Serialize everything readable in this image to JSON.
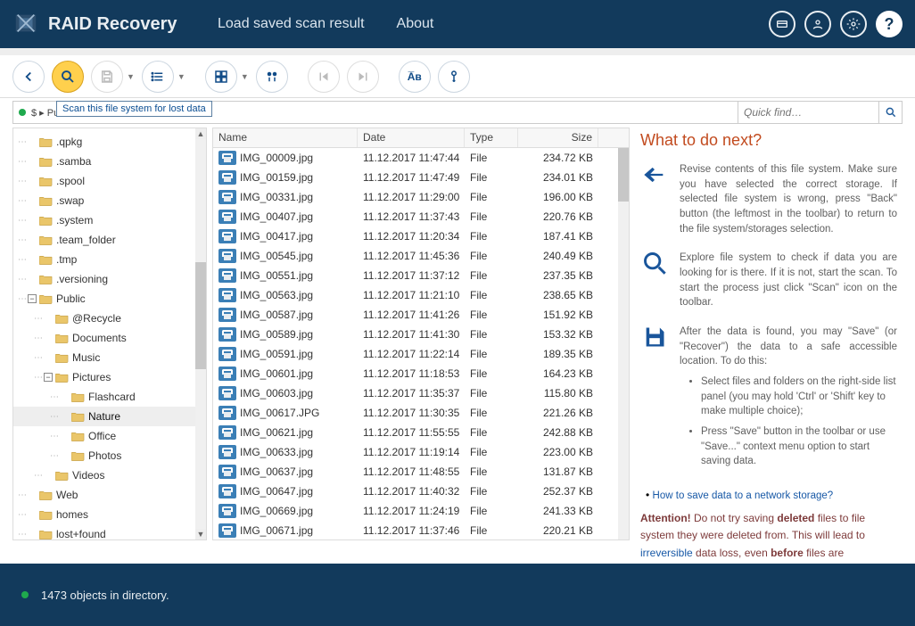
{
  "app_title": "RAID Recovery",
  "menu": {
    "load": "Load saved scan result",
    "about": "About"
  },
  "tooltip": "Scan this file system for lost data",
  "breadcrumb": "$ ▸ Public ▸ Pictures ▸ Nature",
  "quick_find_placeholder": "Quick find…",
  "tree": [
    {
      "depth": 1,
      "label": ".qpkg",
      "expandable": false
    },
    {
      "depth": 1,
      "label": ".samba",
      "expandable": false
    },
    {
      "depth": 1,
      "label": ".spool",
      "expandable": false
    },
    {
      "depth": 1,
      "label": ".swap",
      "expandable": false
    },
    {
      "depth": 1,
      "label": ".system",
      "expandable": false
    },
    {
      "depth": 1,
      "label": ".team_folder",
      "expandable": false
    },
    {
      "depth": 1,
      "label": ".tmp",
      "expandable": false
    },
    {
      "depth": 1,
      "label": ".versioning",
      "expandable": false
    },
    {
      "depth": 1,
      "label": "Public",
      "expandable": true,
      "expanded": true
    },
    {
      "depth": 2,
      "label": "@Recycle",
      "expandable": false
    },
    {
      "depth": 2,
      "label": "Documents",
      "expandable": false
    },
    {
      "depth": 2,
      "label": "Music",
      "expandable": false
    },
    {
      "depth": 2,
      "label": "Pictures",
      "expandable": true,
      "expanded": true
    },
    {
      "depth": 3,
      "label": "Flashcard",
      "expandable": false
    },
    {
      "depth": 3,
      "label": "Nature",
      "expandable": false,
      "selected": true
    },
    {
      "depth": 3,
      "label": "Office",
      "expandable": false
    },
    {
      "depth": 3,
      "label": "Photos",
      "expandable": false
    },
    {
      "depth": 2,
      "label": "Videos",
      "expandable": false
    },
    {
      "depth": 1,
      "label": "Web",
      "expandable": false
    },
    {
      "depth": 1,
      "label": "homes",
      "expandable": false
    },
    {
      "depth": 1,
      "label": "lost+found",
      "expandable": false
    }
  ],
  "columns": {
    "name": "Name",
    "date": "Date",
    "type": "Type",
    "size": "Size"
  },
  "files": [
    {
      "name": "IMG_00009.jpg",
      "date": "11.12.2017 11:47:44",
      "type": "File",
      "size": "234.72 KB"
    },
    {
      "name": "IMG_00159.jpg",
      "date": "11.12.2017 11:47:49",
      "type": "File",
      "size": "234.01 KB"
    },
    {
      "name": "IMG_00331.jpg",
      "date": "11.12.2017 11:29:00",
      "type": "File",
      "size": "196.00 KB"
    },
    {
      "name": "IMG_00407.jpg",
      "date": "11.12.2017 11:37:43",
      "type": "File",
      "size": "220.76 KB"
    },
    {
      "name": "IMG_00417.jpg",
      "date": "11.12.2017 11:20:34",
      "type": "File",
      "size": "187.41 KB"
    },
    {
      "name": "IMG_00545.jpg",
      "date": "11.12.2017 11:45:36",
      "type": "File",
      "size": "240.49 KB"
    },
    {
      "name": "IMG_00551.jpg",
      "date": "11.12.2017 11:37:12",
      "type": "File",
      "size": "237.35 KB"
    },
    {
      "name": "IMG_00563.jpg",
      "date": "11.12.2017 11:21:10",
      "type": "File",
      "size": "238.65 KB"
    },
    {
      "name": "IMG_00587.jpg",
      "date": "11.12.2017 11:41:26",
      "type": "File",
      "size": "151.92 KB"
    },
    {
      "name": "IMG_00589.jpg",
      "date": "11.12.2017 11:41:30",
      "type": "File",
      "size": "153.32 KB"
    },
    {
      "name": "IMG_00591.jpg",
      "date": "11.12.2017 11:22:14",
      "type": "File",
      "size": "189.35 KB"
    },
    {
      "name": "IMG_00601.jpg",
      "date": "11.12.2017 11:18:53",
      "type": "File",
      "size": "164.23 KB"
    },
    {
      "name": "IMG_00603.jpg",
      "date": "11.12.2017 11:35:37",
      "type": "File",
      "size": "115.80 KB"
    },
    {
      "name": "IMG_00617.JPG",
      "date": "11.12.2017 11:30:35",
      "type": "File",
      "size": "221.26 KB"
    },
    {
      "name": "IMG_00621.jpg",
      "date": "11.12.2017 11:55:55",
      "type": "File",
      "size": "242.88 KB"
    },
    {
      "name": "IMG_00633.jpg",
      "date": "11.12.2017 11:19:14",
      "type": "File",
      "size": "223.00 KB"
    },
    {
      "name": "IMG_00637.jpg",
      "date": "11.12.2017 11:48:55",
      "type": "File",
      "size": "131.87 KB"
    },
    {
      "name": "IMG_00647.jpg",
      "date": "11.12.2017 11:40:32",
      "type": "File",
      "size": "252.37 KB"
    },
    {
      "name": "IMG_00669.jpg",
      "date": "11.12.2017 11:24:19",
      "type": "File",
      "size": "241.33 KB"
    },
    {
      "name": "IMG_00671.jpg",
      "date": "11.12.2017 11:37:46",
      "type": "File",
      "size": "220.21 KB"
    }
  ],
  "side": {
    "heading": "What to do next?",
    "step1": "Revise contents of this file system. Make sure you have selected the correct storage. If selected file system is wrong, press \"Back\" button (the leftmost in the toolbar) to return to the file system/storages selection.",
    "step2": "Explore file system to check if data you are looking for is there. If it is not, start the scan. To start the process just click \"Scan\" icon on the toolbar.",
    "step3": "After the data is found, you may \"Save\" (or \"Recover\") the data to a safe accessible location. To do this:",
    "bullet1": "Select files and folders on the right-side list panel (you may hold 'Ctrl' or 'Shift' key to make multiple choice);",
    "bullet2": "Press \"Save\" button in the toolbar or use \"Save...\" context menu option to start saving data.",
    "link": "How to save data to a network storage?",
    "attention_label": "Attention!",
    "attention_1": " Do not try saving ",
    "attention_deleted": "deleted",
    "attention_2": " files to file system they were deleted from. This will lead to ",
    "attention_irrev": "irreversible",
    "attention_3": " data loss, even ",
    "attention_before": "before",
    "attention_4": " files are recovered!"
  },
  "status": "1473 objects in directory."
}
